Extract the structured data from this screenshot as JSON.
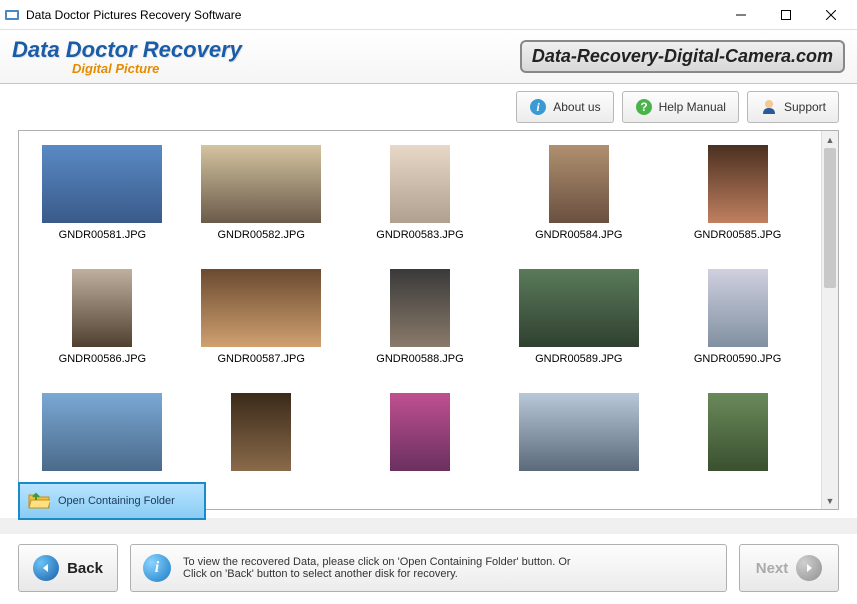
{
  "window": {
    "title": "Data Doctor Pictures Recovery Software"
  },
  "brand": {
    "main": "Data Doctor Recovery",
    "sub": "Digital Picture",
    "site": "Data-Recovery-Digital-Camera.com"
  },
  "toolbar": {
    "about": "About us",
    "help": "Help Manual",
    "support": "Support"
  },
  "files": [
    {
      "name": "GNDR00581.JPG"
    },
    {
      "name": "GNDR00582.JPG"
    },
    {
      "name": "GNDR00583.JPG"
    },
    {
      "name": "GNDR00584.JPG"
    },
    {
      "name": "GNDR00585.JPG"
    },
    {
      "name": "GNDR00586.JPG"
    },
    {
      "name": "GNDR00587.JPG"
    },
    {
      "name": "GNDR00588.JPG"
    },
    {
      "name": "GNDR00589.JPG"
    },
    {
      "name": "GNDR00590.JPG"
    },
    {
      "name": ""
    },
    {
      "name": ""
    },
    {
      "name": ""
    },
    {
      "name": ""
    },
    {
      "name": ""
    }
  ],
  "open_folder": "Open Containing Folder",
  "footer": {
    "back": "Back",
    "next": "Next",
    "info1": "To view the recovered Data, please click on 'Open Containing Folder' button. Or",
    "info2": "Click on 'Back' button to select another disk for recovery."
  }
}
